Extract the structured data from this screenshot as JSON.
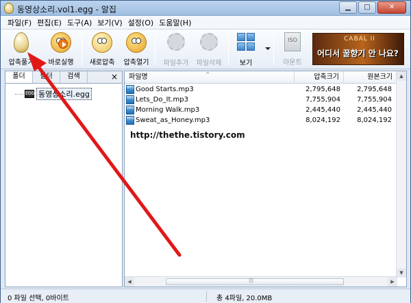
{
  "window": {
    "title": "동영상소리.vol1.egg - 알집"
  },
  "menu": [
    "파일(F)",
    "편집(E)",
    "도구(A)",
    "보기(V)",
    "설정(O)",
    "도움말(H)"
  ],
  "toolbar": {
    "compress_label": "압축풀기",
    "run_label": "바로실행",
    "new_label": "새로압축",
    "open_label": "압축열기",
    "add_label": "파일추가",
    "delete_label": "파일삭제",
    "view_label": "보기",
    "mount_label": "마운트",
    "iso_text": "ISO"
  },
  "ad": {
    "brand": "CABAL II",
    "text": "어디서 꿀향기 안 나요?"
  },
  "left_tabs": [
    "폴더",
    "필터",
    "검색"
  ],
  "close_label": "×",
  "tree": {
    "item_label": "동영상소리.egg",
    "icon_text": "EGG"
  },
  "columns": {
    "name": "파일명",
    "compressed": "압축크기",
    "original": "원본크기"
  },
  "files": [
    {
      "name": "Good Starts.mp3",
      "compressed": "2,795,648",
      "original": "2,795,648"
    },
    {
      "name": "Lets_Do_It.mp3",
      "compressed": "7,755,904",
      "original": "7,755,904"
    },
    {
      "name": "Morning Walk.mp3",
      "compressed": "2,445,440",
      "original": "2,445,440"
    },
    {
      "name": "Sweat_as_Honey.mp3",
      "compressed": "8,024,192",
      "original": "8,024,192"
    }
  ],
  "file_icon_text": "MP3",
  "watermark": "http://thethe.tistory.com",
  "status": {
    "left": "0 파일 선택,  0바이트",
    "right": "총 4파일,  20.0MB"
  },
  "colors": {
    "arrow": "#e01818",
    "titlebar": "#9fbfe3"
  }
}
